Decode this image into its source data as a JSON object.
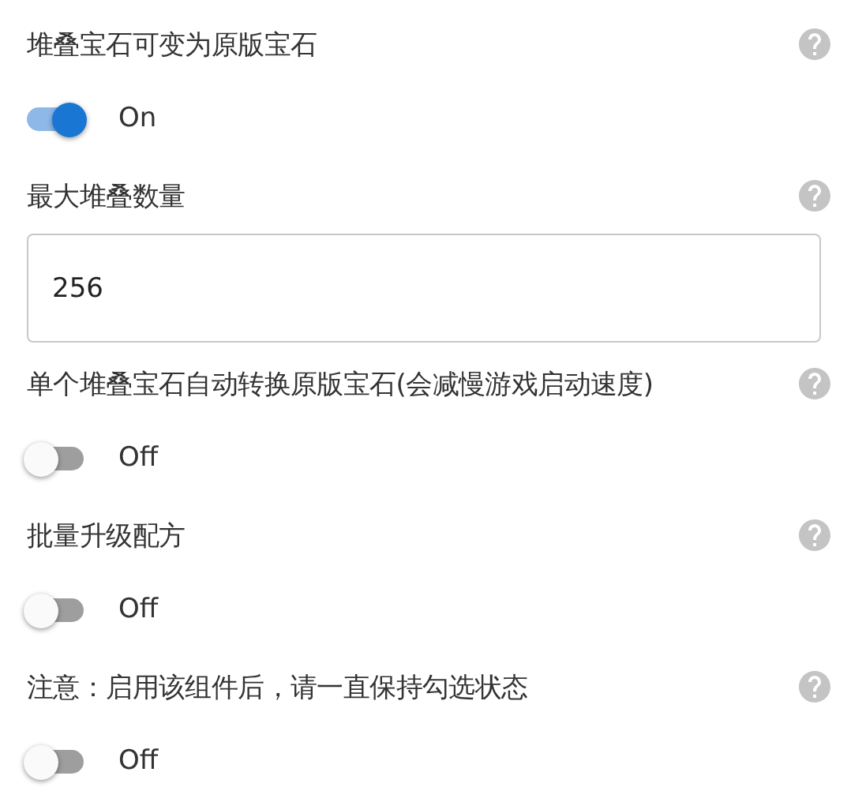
{
  "settings": [
    {
      "kind": "toggle",
      "label": "堆叠宝石可变为原版宝石",
      "on": true,
      "state_label": "On"
    },
    {
      "kind": "number",
      "label": "最大堆叠数量",
      "value": "256"
    },
    {
      "kind": "toggle",
      "label": "单个堆叠宝石自动转换原版宝石(会减慢游戏启动速度)",
      "on": false,
      "state_label": "Off"
    },
    {
      "kind": "toggle",
      "label": "批量升级配方",
      "on": false,
      "state_label": "Off"
    },
    {
      "kind": "toggle",
      "label": "注意：启用该组件后，请一直保持勾选状态",
      "on": false,
      "state_label": "Off"
    }
  ]
}
